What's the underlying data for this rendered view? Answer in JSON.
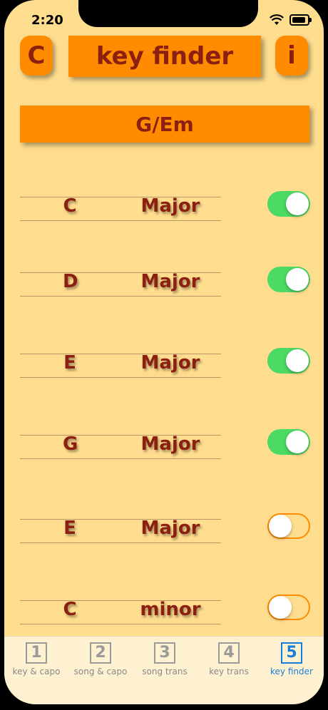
{
  "status": {
    "time": "2:20"
  },
  "header": {
    "left_button": "C",
    "title": "key finder",
    "info_button": "i"
  },
  "key_result": "G/Em",
  "rows": [
    {
      "note": "C",
      "quality": "Major",
      "enabled": true
    },
    {
      "note": "D",
      "quality": "Major",
      "enabled": true
    },
    {
      "note": "E",
      "quality": "Major",
      "enabled": true
    },
    {
      "note": "G",
      "quality": "Major",
      "enabled": true
    },
    {
      "note": "E",
      "quality": "Major",
      "enabled": false
    },
    {
      "note": "C",
      "quality": "minor",
      "enabled": false
    }
  ],
  "tabs": [
    {
      "num": "1",
      "label": "key & capo"
    },
    {
      "num": "2",
      "label": "song & capo"
    },
    {
      "num": "3",
      "label": "song trans"
    },
    {
      "num": "4",
      "label": "key trans"
    },
    {
      "num": "5",
      "label": "key finder"
    }
  ],
  "active_tab": 4,
  "colors": {
    "background": "#ffdd8f",
    "accent": "#ff8c00",
    "text": "#8b1f10",
    "toggle_on": "#4cd964",
    "tab_active": "#1a7ed6"
  }
}
